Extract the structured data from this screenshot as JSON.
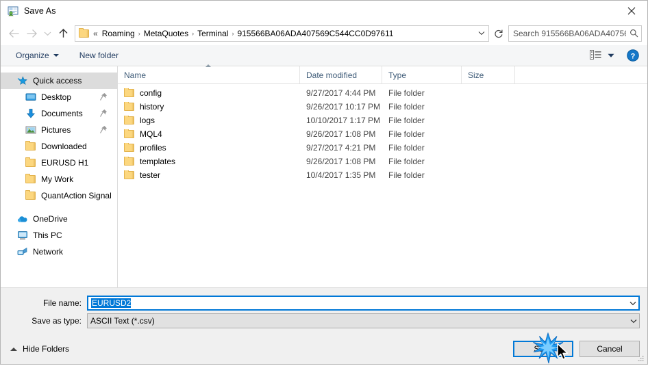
{
  "window": {
    "title": "Save As",
    "icon": "save-as-icon",
    "close_label": "✕"
  },
  "nav": {
    "back": "back-arrow",
    "forward": "forward-arrow",
    "recent": "recent-locations-chevron",
    "up": "up-arrow",
    "refresh": "refresh-icon",
    "dropdown": "address-dropdown-chevron"
  },
  "address": {
    "leading": "«",
    "crumbs": [
      "Roaming",
      "MetaQuotes",
      "Terminal",
      "915566BA06ADA407569C544CC0D97611"
    ],
    "separator": "›"
  },
  "search": {
    "placeholder": "Search 915566BA06ADA40756...",
    "icon": "search-icon"
  },
  "toolbar": {
    "organize": "Organize",
    "new_folder": "New folder",
    "view_icon": "view-layout-icon",
    "view_caret": "chevron-down-icon",
    "help": "?"
  },
  "sidebar": {
    "items": [
      {
        "label": "Quick access",
        "icon": "star-icon",
        "selected": true,
        "indent": false,
        "pinned": false
      },
      {
        "label": "Desktop",
        "icon": "desktop-icon",
        "selected": false,
        "indent": true,
        "pinned": true
      },
      {
        "label": "Documents",
        "icon": "documents-icon",
        "selected": false,
        "indent": true,
        "pinned": true
      },
      {
        "label": "Pictures",
        "icon": "pictures-icon",
        "selected": false,
        "indent": true,
        "pinned": true
      },
      {
        "label": "Downloaded",
        "icon": "folder-icon",
        "selected": false,
        "indent": true,
        "pinned": false
      },
      {
        "label": "EURUSD H1",
        "icon": "folder-icon",
        "selected": false,
        "indent": true,
        "pinned": false
      },
      {
        "label": "My Work",
        "icon": "folder-icon",
        "selected": false,
        "indent": true,
        "pinned": false
      },
      {
        "label": "QuantAction Signal",
        "icon": "folder-icon",
        "selected": false,
        "indent": true,
        "pinned": false
      },
      {
        "label": "OneDrive",
        "icon": "onedrive-icon",
        "selected": false,
        "indent": false,
        "pinned": false
      },
      {
        "label": "This PC",
        "icon": "this-pc-icon",
        "selected": false,
        "indent": false,
        "pinned": false
      },
      {
        "label": "Network",
        "icon": "network-icon",
        "selected": false,
        "indent": false,
        "pinned": false
      }
    ]
  },
  "filelist": {
    "columns": [
      "Name",
      "Date modified",
      "Type",
      "Size"
    ],
    "sort_column": "Name",
    "sort_direction": "ascending",
    "rows": [
      {
        "name": "config",
        "date": "9/27/2017 4:44 PM",
        "type": "File folder",
        "size": ""
      },
      {
        "name": "history",
        "date": "9/26/2017 10:17 PM",
        "type": "File folder",
        "size": ""
      },
      {
        "name": "logs",
        "date": "10/10/2017 1:17 PM",
        "type": "File folder",
        "size": ""
      },
      {
        "name": "MQL4",
        "date": "9/26/2017 1:08 PM",
        "type": "File folder",
        "size": ""
      },
      {
        "name": "profiles",
        "date": "9/27/2017 4:21 PM",
        "type": "File folder",
        "size": ""
      },
      {
        "name": "templates",
        "date": "9/26/2017 1:08 PM",
        "type": "File folder",
        "size": ""
      },
      {
        "name": "tester",
        "date": "10/4/2017 1:35 PM",
        "type": "File folder",
        "size": ""
      }
    ]
  },
  "form": {
    "filename_label": "File name:",
    "filename_value": "EURUSD2",
    "filetype_label": "Save as type:",
    "filetype_value": "ASCII Text (*.csv)"
  },
  "footer": {
    "hide_folders": "Hide Folders",
    "save": "Save",
    "cancel": "Cancel"
  },
  "colors": {
    "accent": "#0078d7",
    "selection": "#0078d7",
    "folder": "#fcd77f",
    "toolbar_bg": "#f5f6f7",
    "panel_bg": "#f0f0f0"
  }
}
